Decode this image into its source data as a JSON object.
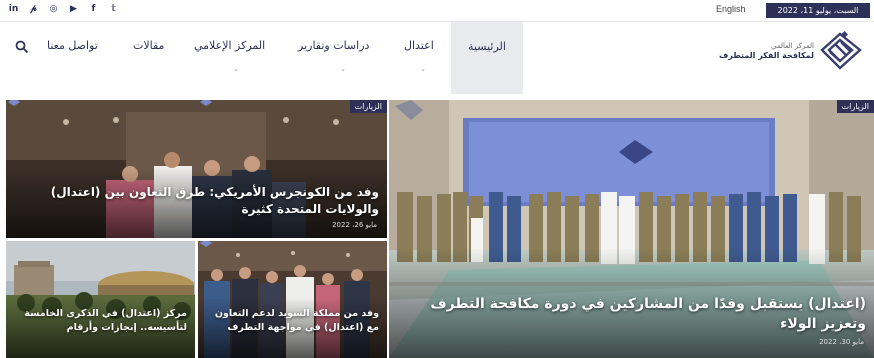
{
  "topbar": {
    "social_icons": [
      "linkedin-icon",
      "pinterest-icon",
      "instagram-icon",
      "youtube-icon",
      "facebook-icon",
      "twitter-icon"
    ],
    "social_glyphs": [
      "in",
      "𝓅",
      "◎",
      "▶",
      "f",
      "𝕥"
    ],
    "language": "English",
    "date": "السبت، يوليو 11، 2022"
  },
  "nav": {
    "home": "الرئيسية",
    "items": [
      "اعتدال",
      "دراسات وتقارير",
      "المركز الإعلامي",
      "مقالات",
      "تواصل معنا"
    ]
  },
  "logo": {
    "line1": "المركز العالمي",
    "line2": "لمكافحة الفكر المتطرف"
  },
  "articles": [
    {
      "tag": "الزيارات",
      "title": "(اعتدال) يستقبل وفدًا من المشاركين في دورة مكافحة التطرف وتعزيز الولاء",
      "date": "مايو 30، 2022"
    },
    {
      "tag": "الزيارات",
      "title": "وفد من الكونجرس الأمريكي: طرق التعاون بين (اعتدال) والولايات المتحدة كثيرة",
      "date": "مايو 26، 2022"
    },
    {
      "tag": "",
      "title": "وفد من مملكة السويد لدعم التعاون مع (اعتدال) في مواجهة التطرف",
      "date": ""
    },
    {
      "tag": "",
      "title": "مركز (اعتدال) في الذكرى الخامسة لتأسيسه.. إنجازات وأرقام",
      "date": ""
    }
  ],
  "colors": {
    "brand": "#2d3157",
    "nav_active_bg": "#e9eaee"
  }
}
